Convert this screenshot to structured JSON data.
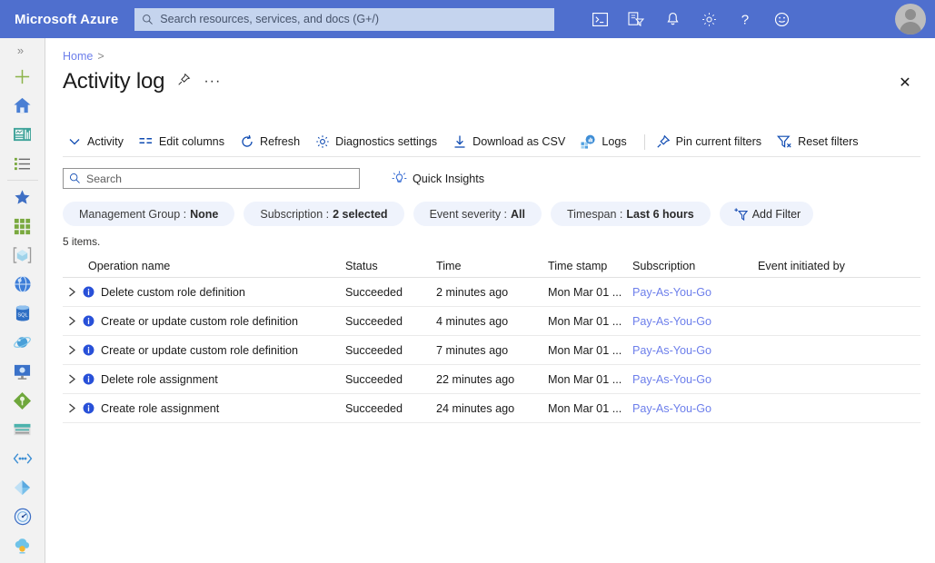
{
  "topbar": {
    "brand": "Microsoft Azure",
    "search_placeholder": "Search resources, services, and docs (G+/)",
    "icons": [
      {
        "name": "cloud-shell-icon",
        "label": "Cloud Shell"
      },
      {
        "name": "directory-filter-icon",
        "label": "Directories + subscriptions"
      },
      {
        "name": "notifications-bell-icon",
        "label": "Notifications"
      },
      {
        "name": "settings-gear-icon",
        "label": "Settings"
      },
      {
        "name": "help-question-icon",
        "label": "Help"
      },
      {
        "name": "feedback-smiley-icon",
        "label": "Feedback"
      }
    ],
    "avatar_name": "user-avatar"
  },
  "rail": {
    "expand_glyph": "»",
    "items": [
      {
        "name": "sidebar-item-create-resource",
        "label": "Create a resource"
      },
      {
        "name": "sidebar-item-home",
        "label": "Home"
      },
      {
        "name": "sidebar-item-dashboard",
        "label": "Dashboard"
      },
      {
        "name": "sidebar-item-all-services",
        "label": "All services"
      },
      {
        "name": "sidebar-item-favorites",
        "label": "Favorites"
      },
      {
        "name": "sidebar-item-all-resources",
        "label": "All resources"
      },
      {
        "name": "sidebar-item-resource-groups",
        "label": "Resource groups"
      },
      {
        "name": "sidebar-item-app-services",
        "label": "App Services"
      },
      {
        "name": "sidebar-item-sql-databases",
        "label": "SQL databases"
      },
      {
        "name": "sidebar-item-azure-cosmos-db",
        "label": "Azure Cosmos DB"
      },
      {
        "name": "sidebar-item-virtual-machines",
        "label": "Virtual machines"
      },
      {
        "name": "sidebar-item-load-balancers",
        "label": "Load balancers"
      },
      {
        "name": "sidebar-item-storage-accounts",
        "label": "Storage accounts"
      },
      {
        "name": "sidebar-item-virtual-networks",
        "label": "Virtual networks"
      },
      {
        "name": "sidebar-item-azure-active-directory",
        "label": "Azure Active Directory"
      },
      {
        "name": "sidebar-item-monitor",
        "label": "Monitor"
      },
      {
        "name": "sidebar-item-advisor",
        "label": "Advisor"
      }
    ]
  },
  "header": {
    "breadcrumb_home": "Home",
    "breadcrumb_sep": ">",
    "title": "Activity log",
    "pin_icon": "pin-icon",
    "more_dots": "···",
    "close_glyph": "✕"
  },
  "toolbar": {
    "items": [
      {
        "name": "toolbar-activity",
        "label": "Activity",
        "icon": "chevron-down-icon"
      },
      {
        "name": "toolbar-edit-columns",
        "label": "Edit columns",
        "icon": "edit-columns-icon"
      },
      {
        "name": "toolbar-refresh",
        "label": "Refresh",
        "icon": "refresh-icon"
      },
      {
        "name": "toolbar-diagnostics-settings",
        "label": "Diagnostics settings",
        "icon": "gear-icon"
      },
      {
        "name": "toolbar-download-as-csv",
        "label": "Download as CSV",
        "icon": "download-icon"
      },
      {
        "name": "toolbar-logs",
        "label": "Logs",
        "icon": "logs-icon"
      },
      {
        "name": "toolbar-pin-current-filters",
        "label": "Pin current filters",
        "icon": "pin-icon"
      },
      {
        "name": "toolbar-reset-filters",
        "label": "Reset filters",
        "icon": "reset-filter-icon"
      }
    ]
  },
  "search": {
    "placeholder": "Search",
    "value": "",
    "quick_insights_label": "Quick Insights",
    "quick_insights_icon": "lightbulb-icon"
  },
  "filters": [
    {
      "name": "filter-management-group",
      "label": "Management Group :",
      "value": "None"
    },
    {
      "name": "filter-subscription",
      "label": "Subscription :",
      "value": "2 selected"
    },
    {
      "name": "filter-event-severity",
      "label": "Event severity :",
      "value": "All"
    },
    {
      "name": "filter-timespan",
      "label": "Timespan :",
      "value": "Last 6 hours"
    }
  ],
  "add_filter": {
    "label": "Add Filter",
    "icon": "add-filter-icon"
  },
  "table": {
    "item_count": "5 items.",
    "columns": [
      "Operation name",
      "Status",
      "Time",
      "Time stamp",
      "Subscription",
      "Event initiated by"
    ],
    "rows": [
      {
        "operation": "Delete custom role definition",
        "status": "Succeeded",
        "time": "2 minutes ago",
        "timestamp": "Mon Mar 01 ...",
        "subscription": "Pay-As-You-Go",
        "initiated_by": ""
      },
      {
        "operation": "Create or update custom role definition",
        "status": "Succeeded",
        "time": "4 minutes ago",
        "timestamp": "Mon Mar 01 ...",
        "subscription": "Pay-As-You-Go",
        "initiated_by": ""
      },
      {
        "operation": "Create or update custom role definition",
        "status": "Succeeded",
        "time": "7 minutes ago",
        "timestamp": "Mon Mar 01 ...",
        "subscription": "Pay-As-You-Go",
        "initiated_by": ""
      },
      {
        "operation": "Delete role assignment",
        "status": "Succeeded",
        "time": "22 minutes ago",
        "timestamp": "Mon Mar 01 ...",
        "subscription": "Pay-As-You-Go",
        "initiated_by": ""
      },
      {
        "operation": "Create role assignment",
        "status": "Succeeded",
        "time": "24 minutes ago",
        "timestamp": "Mon Mar 01 ...",
        "subscription": "Pay-As-You-Go",
        "initiated_by": ""
      }
    ]
  },
  "colors": {
    "header_blue": "#4f6fce",
    "link_blue": "#6d7feb",
    "pill_bg": "#eff3fc",
    "rail_bg": "#f2f2f2",
    "info_blue": "#2850d8"
  }
}
